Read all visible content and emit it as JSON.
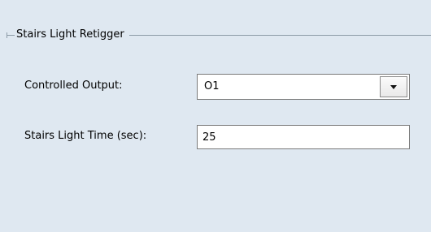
{
  "group": {
    "title": "Stairs Light Retigger"
  },
  "fields": {
    "controlled_output": {
      "label": "Controlled Output:",
      "value": "O1"
    },
    "stairs_light_time": {
      "label": "Stairs Light Time (sec):",
      "value": "25"
    }
  },
  "icons": {
    "dropdown": "chevron-down-icon"
  }
}
